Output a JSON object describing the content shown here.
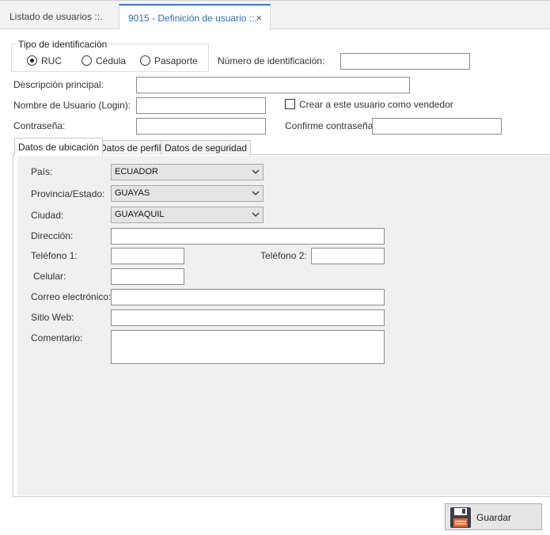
{
  "doc_tabs": {
    "inactive_label": "Listado de usuarios ::.",
    "active_label": "9015 - Definición de usuario ::.",
    "close_glyph": "×"
  },
  "id_type": {
    "group_title": "Tipo de identificación",
    "options": [
      "RUC",
      "Cédula",
      "Pasaporte"
    ],
    "selected": "RUC"
  },
  "form": {
    "id_number_label": "Número de identificación:",
    "id_number_value": "",
    "description_label": "Descripción principal:",
    "description_value": "",
    "login_label": "Nombre de Usuario (Login):",
    "login_value": "",
    "seller_checkbox_label": "Crear a este usuario como vendedor",
    "seller_checked": false,
    "password_label": "Contraseña:",
    "password_value": "",
    "confirm_password_label": "Confirme contraseña:",
    "confirm_password_value": ""
  },
  "inner_tabs": {
    "items": [
      "Datos de ubicación",
      "Datos de perfil",
      "Datos de seguridad"
    ],
    "active": "Datos de ubicación"
  },
  "location": {
    "country_label": "País:",
    "country_value": "ECUADOR",
    "province_label": "Provincia/Estado:",
    "province_value": "GUAYAS",
    "city_label": "Ciudad:",
    "city_value": "GUAYAQUIL",
    "address_label": "Dirección:",
    "phone1_label": "Teléfono 1:",
    "phone2_label": "Teléfono 2:",
    "mobile_label": "Celular:",
    "email_label": "Correo electrónico:",
    "website_label": "Sitio Web:",
    "comment_label": "Comentario:"
  },
  "actions": {
    "save_label": "Guardar",
    "save_icon": "floppy-disk-icon"
  },
  "colors": {
    "accent": "#3c78c8",
    "panel_bg": "#f0f0f0",
    "select_bg": "#e5e5e5"
  }
}
